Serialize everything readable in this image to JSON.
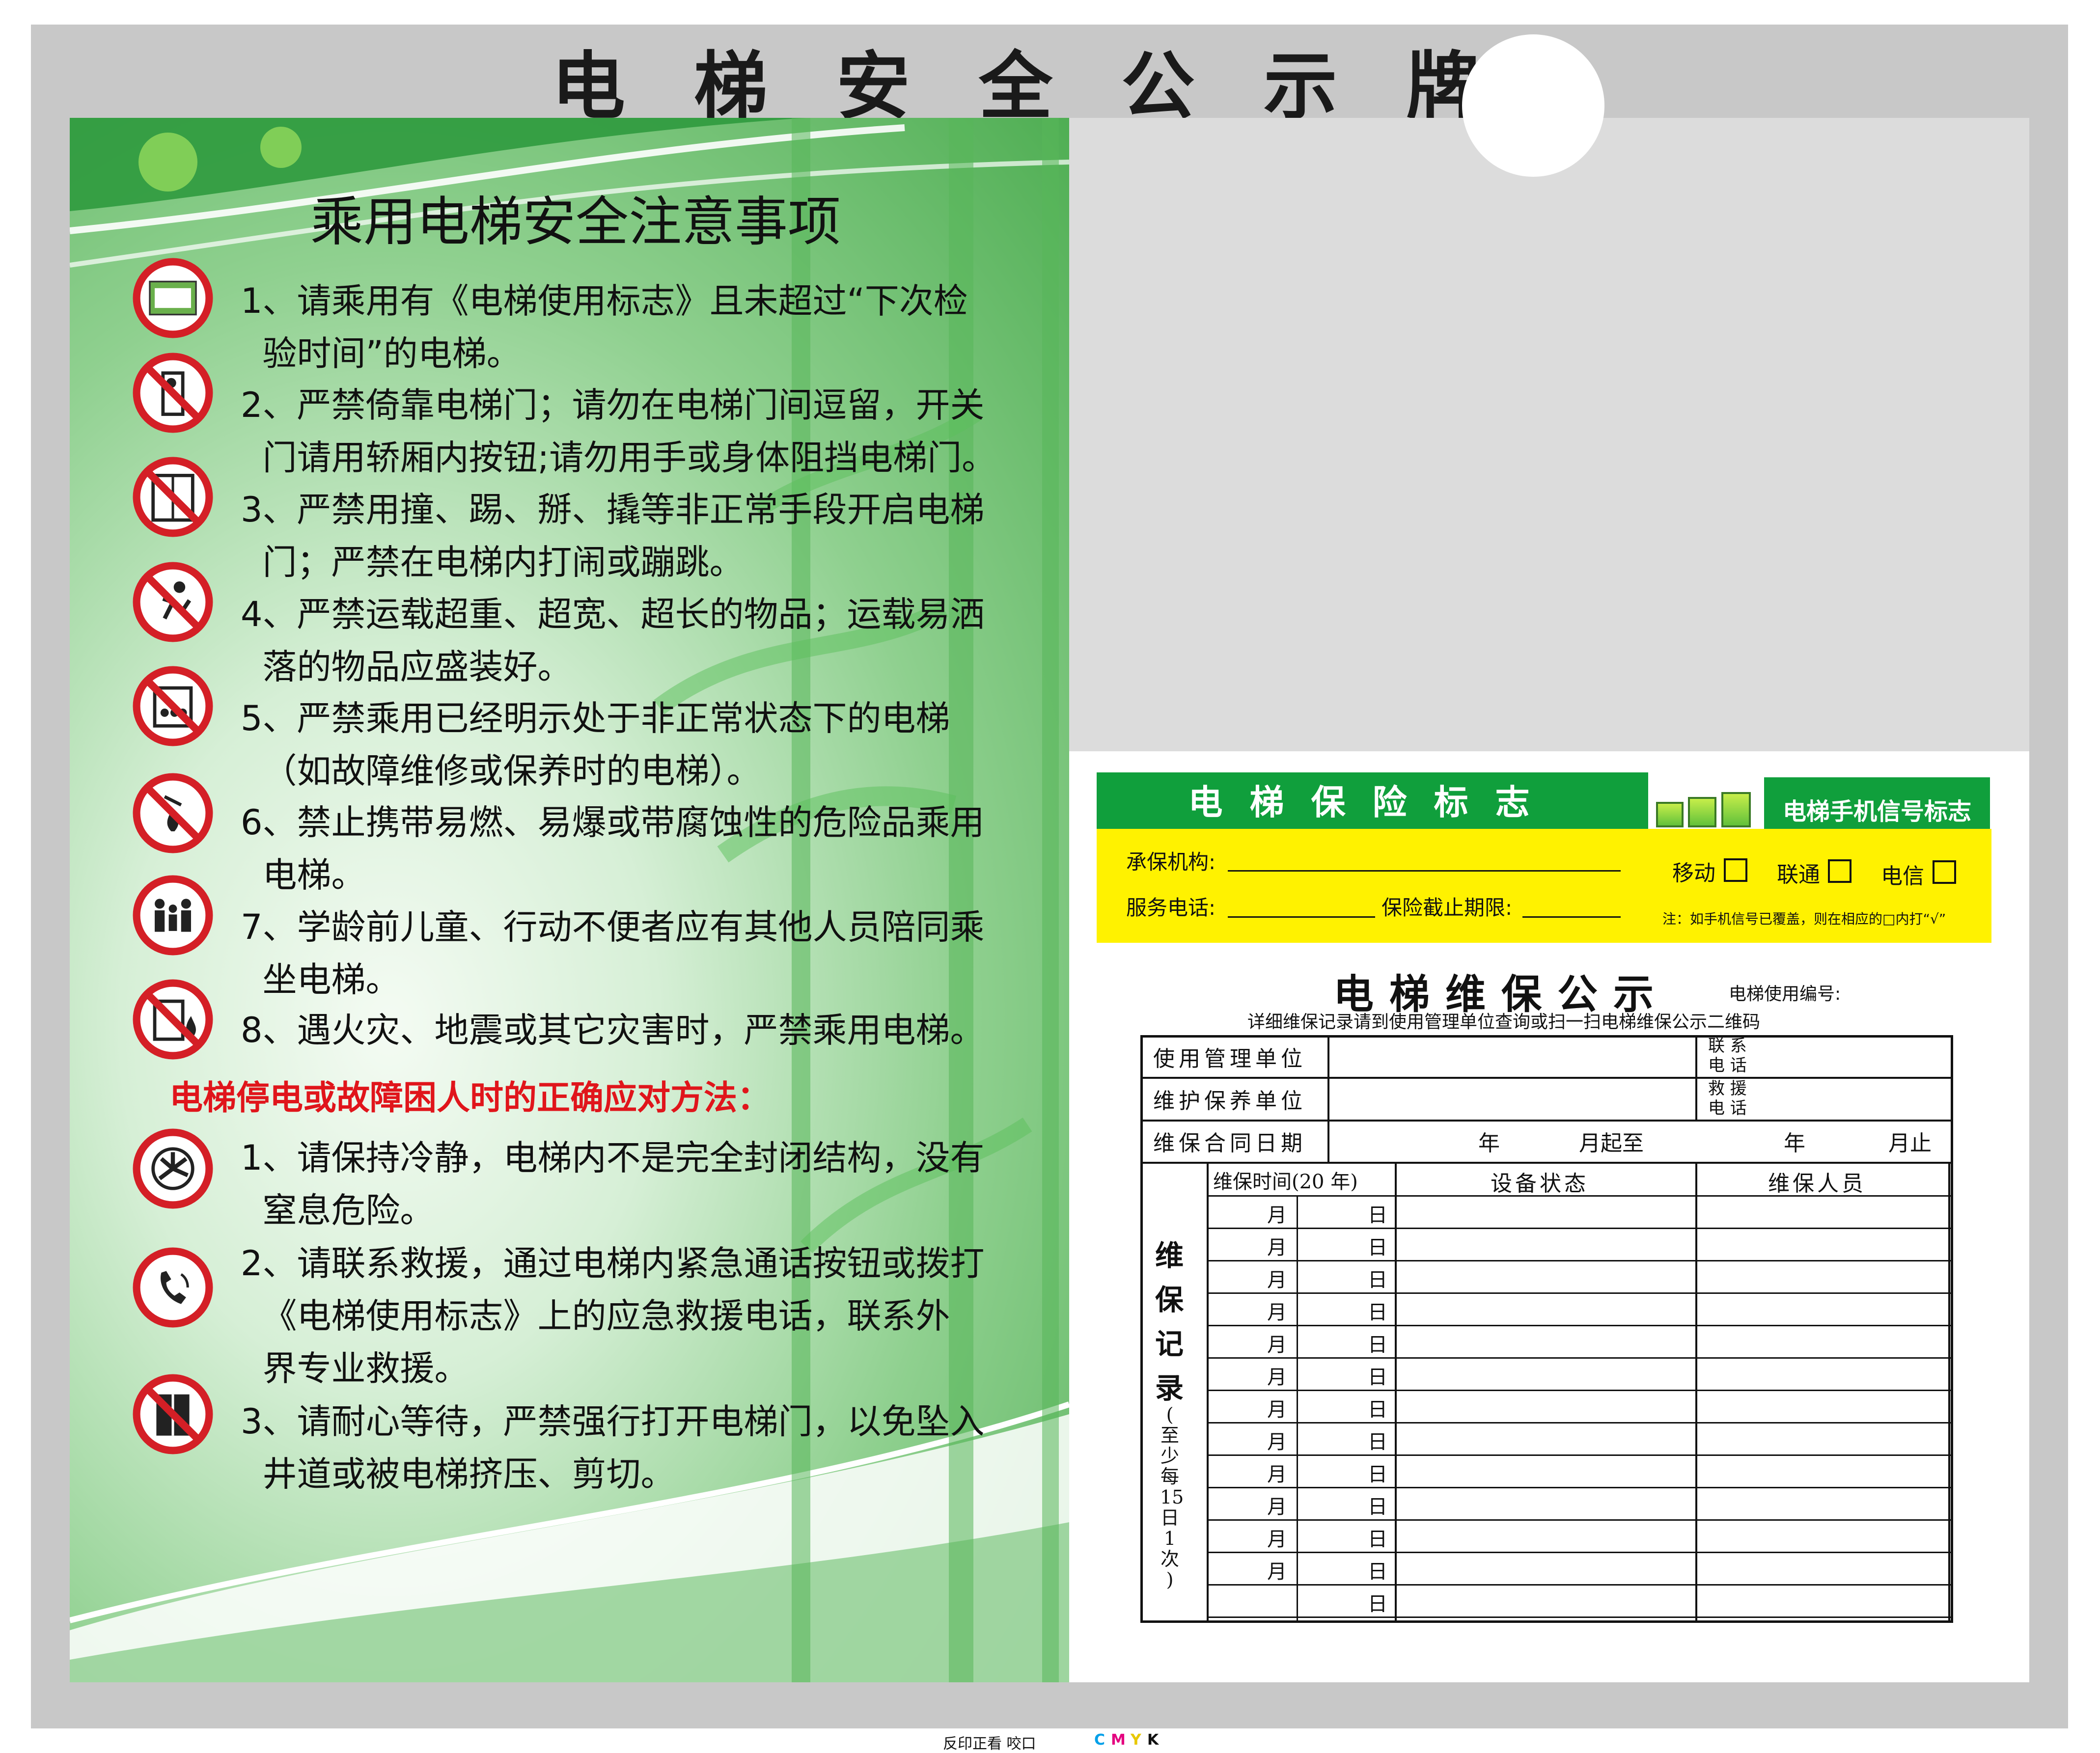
{
  "board": {
    "title": "电梯安全公示牌"
  },
  "instructions": {
    "title": "乘用电梯安全注意事项",
    "rules": [
      {
        "num": "1、",
        "line1": "请乘用有《电梯使用标志》且未超过“下次检",
        "line2": "验时间”的电梯。"
      },
      {
        "num": "2、",
        "line1": "严禁倚靠电梯门；请勿在电梯门间逗留，开关",
        "line2": "门请用轿厢内按钮;请勿用手或身体阻挡电梯门。"
      },
      {
        "num": "3、",
        "line1": "严禁用撞、踢、掰、撬等非正常手段开启电梯",
        "line2": "门；严禁在电梯内打闹或蹦跳。"
      },
      {
        "num": "4、",
        "line1": "严禁运载超重、超宽、超长的物品；运载易洒",
        "line2": "落的物品应盛装好。"
      },
      {
        "num": "5、",
        "line1": "严禁乘用已经明示处于非正常状态下的电梯",
        "line2": "（如故障维修或保养时的电梯）。"
      },
      {
        "num": "6、",
        "line1": "禁止携带易燃、易爆或带腐蚀性的危险品乘用",
        "line2": "电梯。"
      },
      {
        "num": "7、",
        "line1": "学龄前儿童、行动不便者应有其他人员陪同乘",
        "line2": "坐电梯。"
      },
      {
        "num": "8、",
        "line1": "遇火灾、地震或其它灾害时，严禁乘用电梯。",
        "line2": ""
      }
    ],
    "emergency_heading": "电梯停电或故障困人时的正确应对方法：",
    "emergency": [
      {
        "num": "1、",
        "line1": "请保持冷静，电梯内不是完全封闭结构，没有",
        "line2": "窒息危险。",
        "line3": ""
      },
      {
        "num": "2、",
        "line1": "请联系救援，通过电梯内紧急通话按钮或拨打",
        "line2": "《电梯使用标志》上的应急救援电话，联系外",
        "line3": "界专业救援。"
      },
      {
        "num": "3、",
        "line1": "请耐心等待，严禁强行打开电梯门，以免坠入",
        "line2": "井道或被电梯挤压、剪切。",
        "line3": ""
      }
    ],
    "sign_icons": [
      "usage-certificate-icon",
      "no-leaning-door-icon",
      "no-forcing-door-icon",
      "no-jumping-icon",
      "no-overload-icon",
      "no-flammables-icon",
      "children-accompanied-icon",
      "no-use-in-fire-icon",
      "fan-ventilation-icon",
      "emergency-phone-icon",
      "do-not-force-door-icon"
    ]
  },
  "insurance": {
    "title": "电梯保险标志",
    "insurer_label": "承保机构:",
    "phone_label": "服务电话:",
    "expiry_label": "保险截止期限:",
    "signal_title": "电梯手机信号标志",
    "carriers": [
      "移动",
      "联通",
      "电信"
    ],
    "note": "注：如手机信号已覆盖，则在相应的□内打“√”",
    "colors": {
      "green": "#109f3c",
      "yellow": "#fff200"
    }
  },
  "maintenance": {
    "title": "电梯维保公示",
    "id_label": "电梯使用编号:",
    "subtitle": "详细维保记录请到使用管理单位查询或扫一扫电梯维保公示二维码",
    "rows": {
      "user_unit": "使用管理单位",
      "maintainer": "维护保养单位",
      "contract": "维保合同日期",
      "contact_1": "联  系",
      "contact_2": "电  话",
      "rescue_1": "救  援",
      "rescue_2": "电  话",
      "year1": "年",
      "month_from": "月起至",
      "year2": "年",
      "month_to": "月止"
    },
    "record_label": [
      "维",
      "保",
      "记",
      "录"
    ],
    "record_note": [
      "(",
      "至",
      "少",
      "每",
      "15",
      "日",
      "1",
      "次",
      ")"
    ],
    "headers": {
      "date": "维保时间(20    年)",
      "status": "设备状态",
      "staff": "维保人员"
    },
    "month": "月",
    "day": "日",
    "record_rows": 13,
    "month_rows": 12
  },
  "print_marks": {
    "note": "反印正看  咬口",
    "cmyk": [
      "C",
      "M",
      "Y",
      "K"
    ]
  }
}
